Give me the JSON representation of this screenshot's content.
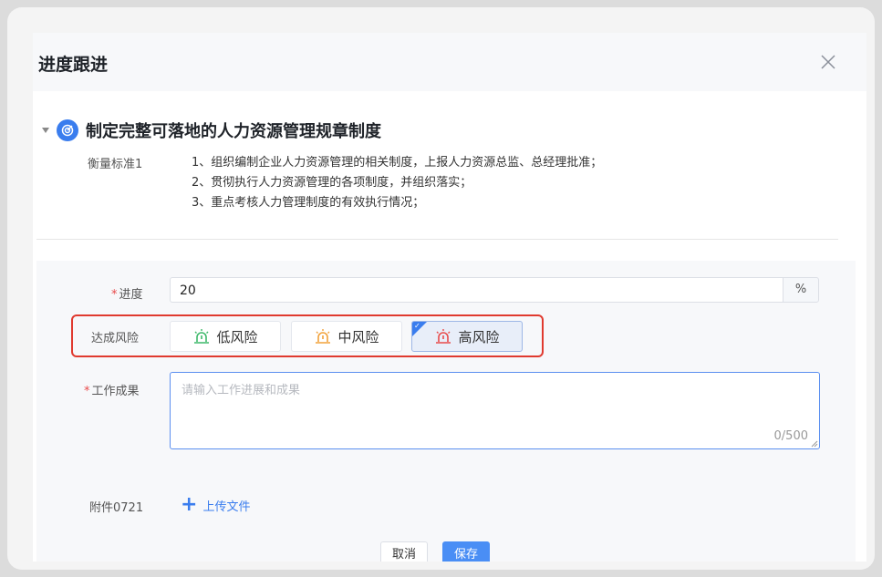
{
  "dialog": {
    "title": "进度跟进",
    "close_icon": "close-icon"
  },
  "goal": {
    "title": "制定完整可落地的人力资源管理规章制度",
    "icon": "target-icon",
    "criteria_label": "衡量标准1",
    "criteria": [
      "1、组织编制企业人力资源管理的相关制度，上报人力资源总监、总经理批准；",
      "2、贯彻执行人力资源管理的各项制度，并组织落实；",
      "3、重点考核人力管理制度的有效执行情况；"
    ]
  },
  "form": {
    "progress": {
      "required_mark": "*",
      "label": "进度",
      "value": "20",
      "suffix": "%"
    },
    "risk": {
      "label": "达成风险",
      "options": [
        {
          "label": "低风险",
          "color": "#3db86a",
          "selected": false
        },
        {
          "label": "中风险",
          "color": "#f2a23a",
          "selected": false
        },
        {
          "label": "高风险",
          "color": "#e84a4a",
          "selected": true
        }
      ],
      "highlight_color": "#e03a2f"
    },
    "result": {
      "required_mark": "*",
      "label": "工作成果",
      "placeholder": "请输入工作进展和成果",
      "counter": "0/500"
    },
    "attachment": {
      "label": "附件0721",
      "upload_plus": "+",
      "upload_label": "上传文件"
    },
    "buttons": {
      "cancel": "取消",
      "save": "保存"
    }
  },
  "colors": {
    "accent": "#3a7dee",
    "save_button": "#4a8ef5"
  }
}
